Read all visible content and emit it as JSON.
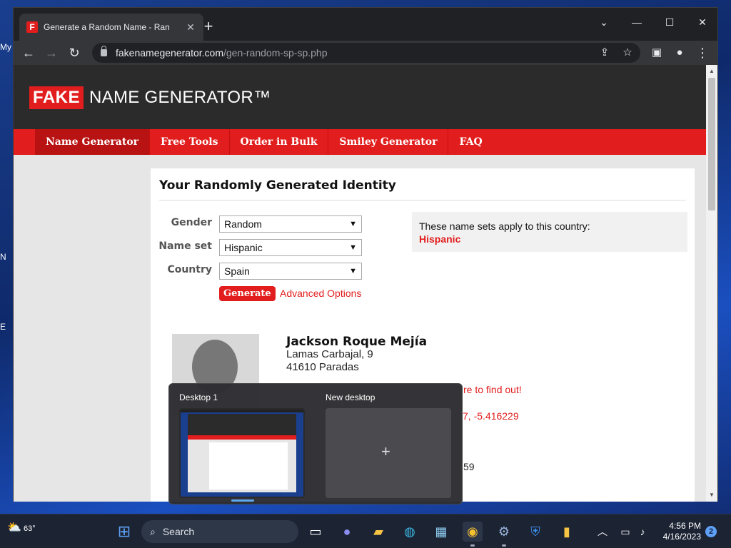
{
  "desktop": {
    "fragments": [
      "My",
      "N",
      "E"
    ]
  },
  "browser": {
    "tab_title": "Generate a Random Name - Ran",
    "favicon_letter": "F",
    "url_domain": "fakenamegenerator.com",
    "url_path": "/gen-random-sp-sp.php"
  },
  "site": {
    "logo_fake": "FAKE",
    "logo_rest": "NAME GENERATOR™",
    "nav": [
      "Name Generator",
      "Free Tools",
      "Order in Bulk",
      "Smiley Generator",
      "FAQ"
    ],
    "card_title": "Your Randomly Generated Identity",
    "form": {
      "gender_label": "Gender",
      "gender_value": "Random",
      "nameset_label": "Name set",
      "nameset_value": "Hispanic",
      "country_label": "Country",
      "country_value": "Spain",
      "generate_label": "Generate",
      "advanced_label": "Advanced Options"
    },
    "country_box": {
      "text": "These name sets apply to this country:",
      "highlight": "Hispanic"
    },
    "identity": {
      "name": "Jackson Roque Mejía",
      "address_line1": "Lamas Carbajal, 9",
      "address_line2": "41610 Paradas",
      "frag_link": "re to find out!",
      "frag_coords": "7, -5.416229",
      "frag_number": "59"
    }
  },
  "taskview": {
    "desktop1_label": "Desktop 1",
    "new_desktop_label": "New desktop",
    "add_glyph": "+"
  },
  "taskbar": {
    "weather_temp": "63°",
    "search_placeholder": "Search",
    "time": "4:56 PM",
    "date": "4/16/2023",
    "notification_count": "2"
  }
}
